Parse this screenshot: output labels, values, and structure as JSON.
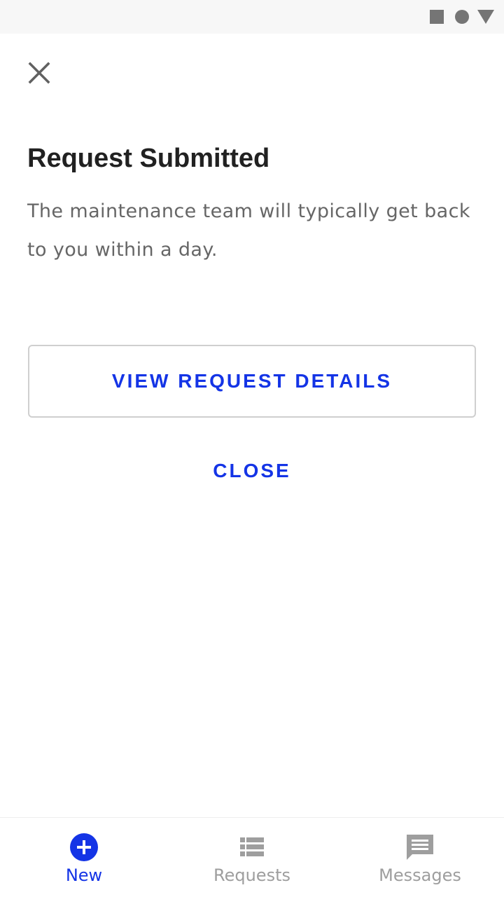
{
  "status_bar": {
    "icons": [
      "square-icon",
      "circle-icon",
      "triangle-icon"
    ],
    "icon_color": "#757575"
  },
  "dialog": {
    "close_icon": "close-icon",
    "title": "Request Submitted",
    "message": "The maintenance team will typically get back to you within a day.",
    "primary_action": "VIEW REQUEST DETAILS",
    "secondary_action": "CLOSE"
  },
  "bottom_nav": {
    "items": [
      {
        "label": "New",
        "icon": "add-circle-icon",
        "active": true
      },
      {
        "label": "Requests",
        "icon": "list-icon",
        "active": false
      },
      {
        "label": "Messages",
        "icon": "message-icon",
        "active": false
      }
    ]
  },
  "colors": {
    "accent": "#1434e6",
    "title_text": "#212121",
    "body_text": "#666666",
    "inactive_nav": "#9e9e9e"
  }
}
